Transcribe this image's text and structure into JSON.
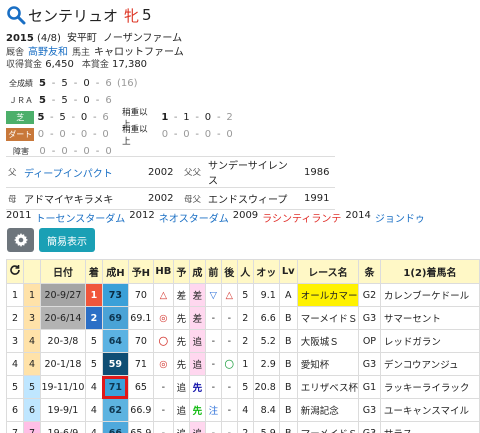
{
  "horse": {
    "name": "センテリュオ",
    "sex": "牝",
    "age": "5"
  },
  "profile": {
    "birth_year": "2015",
    "birth_date": "(4/8)",
    "area": "安平町",
    "breeder": "ノーザンファーム",
    "trainer_label": "厩舎",
    "trainer": "高野友和",
    "owner_label": "馬主",
    "owner": "キャロットファーム",
    "earnings_label": "収得賞金",
    "earnings": "6,450",
    "prize_label": "本賞金",
    "prize": "17,380"
  },
  "records": [
    {
      "label": "全成績",
      "w": "5",
      "s": "5",
      "t": "0",
      "o": "6",
      "extra": "(16)"
    },
    {
      "label": "ＪＲＡ",
      "w": "5",
      "s": "5",
      "t": "0",
      "o": "6"
    },
    {
      "label": "芝",
      "w": "5",
      "s": "5",
      "t": "0",
      "o": "6",
      "tag": "稍重以上",
      "w2": "1",
      "s2": "1",
      "t2": "0",
      "o2": "2"
    },
    {
      "label": "ダート",
      "w": "0",
      "s": "0",
      "t": "0",
      "o": "0",
      "tag": "稍重以上",
      "w2": "0",
      "s2": "0",
      "t2": "0",
      "o2": "0"
    },
    {
      "label": "障害",
      "w": "0",
      "s": "0",
      "t": "0",
      "o": "0"
    }
  ],
  "pedigree": [
    {
      "k1": "父",
      "n1": "ディープインパクト",
      "y1": "2002",
      "k2": "父父",
      "n2": "サンデーサイレンス",
      "y2": "1986"
    },
    {
      "k1": "母",
      "n1": "アドマイヤキラメキ",
      "y1": "2002",
      "k2": "母父",
      "n2": "エンドスウィープ",
      "y2": "1991"
    }
  ],
  "siblings": [
    {
      "year": "2011",
      "name": "トーセンスターダム"
    },
    {
      "year": "2012",
      "name": "ネオスターダム"
    },
    {
      "year": "2009",
      "name": "ラシンティランテ"
    },
    {
      "year": "2014",
      "name": "ジョンドゥ"
    }
  ],
  "buttons": {
    "simple": "簡易表示"
  },
  "table": {
    "headers": [
      "日付",
      "着",
      "成H",
      "予H",
      "HB",
      "予",
      "成",
      "前",
      "後",
      "人",
      "オッ",
      "Lv",
      "レース名",
      "条",
      "1(2)着馬名"
    ],
    "rows": [
      {
        "no": "1",
        "w": "1",
        "date": "20-9/27",
        "fin": "1",
        "gt": "73",
        "yh": "70",
        "hb": "△",
        "yo": "差",
        "sei": "差",
        "mae": "▽",
        "ato": "△",
        "pop": "5",
        "odds": "9.1",
        "lv": "A",
        "race": "オールカマー",
        "cls": "G2",
        "winner": "カレンブーケドール"
      },
      {
        "no": "2",
        "w": "3",
        "date": "20-6/14",
        "fin": "2",
        "gt": "69",
        "yh": "69.1",
        "hb": "◎",
        "yo": "先",
        "sei": "差",
        "mae": "-",
        "ato": "-",
        "pop": "2",
        "odds": "6.6",
        "lv": "B",
        "race": "マーメイドＳ",
        "cls": "G3",
        "winner": "サマーセント"
      },
      {
        "no": "3",
        "w": "4",
        "date": "20-3/8",
        "fin": "5",
        "gt": "64",
        "yh": "70",
        "hb": "〇",
        "yo": "先",
        "sei": "追",
        "mae": "-",
        "ato": "-",
        "pop": "2",
        "odds": "5.2",
        "lv": "B",
        "race": "大阪城Ｓ",
        "cls": "OP",
        "winner": "レッドガラン"
      },
      {
        "no": "4",
        "w": "4",
        "date": "20-1/18",
        "fin": "5",
        "gt": "59",
        "yh": "71",
        "hb": "◎",
        "yo": "先",
        "sei": "追",
        "mae": "-",
        "ato": "〇",
        "pop": "1",
        "odds": "2.9",
        "lv": "B",
        "race": "愛知杯",
        "cls": "G3",
        "winner": "デンコウアンジュ"
      },
      {
        "no": "5",
        "w": "5",
        "date": "19-11/10",
        "fin": "4",
        "gt": "71",
        "yh": "65",
        "hb": "-",
        "yo": "追",
        "sei": "先",
        "mae": "-",
        "ato": "-",
        "pop": "5",
        "odds": "20.8",
        "lv": "B",
        "race": "エリザベス杯",
        "cls": "G1",
        "winner": "ラッキーライラック"
      },
      {
        "no": "6",
        "w": "6",
        "date": "19-9/1",
        "fin": "4",
        "gt": "62",
        "yh": "66.9",
        "hb": "-",
        "yo": "追",
        "sei": "先",
        "mae": "注",
        "ato": "-",
        "pop": "4",
        "odds": "8.4",
        "lv": "B",
        "race": "新潟記念",
        "cls": "G3",
        "winner": "ユーキャンスマイル"
      },
      {
        "no": "7",
        "w": "7",
        "date": "19-6/9",
        "fin": "4",
        "gt": "66",
        "yh": "65.9",
        "hb": "-",
        "yo": "追",
        "sei": "追",
        "mae": "-",
        "ato": "-",
        "pop": "2",
        "odds": "5.9",
        "lv": "B",
        "race": "マーメイドＳ",
        "cls": "G3",
        "winner": "サラス"
      }
    ]
  },
  "colors": {
    "accent": "#1aa0b5",
    "link": "#1a6fc4",
    "header_bg": "#fff8c6",
    "highlight_border": "#e01818"
  }
}
